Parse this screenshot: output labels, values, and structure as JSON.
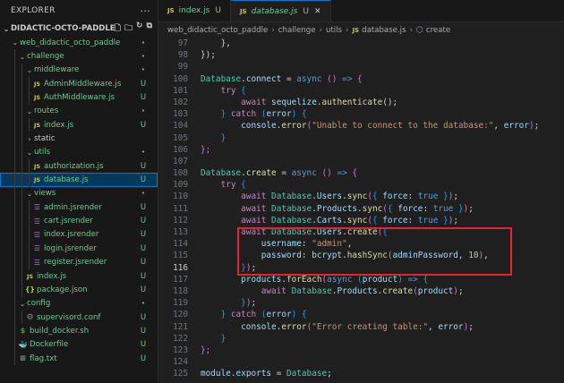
{
  "sidebar": {
    "title": "EXPLORER",
    "more": "···",
    "project": "DIDACTIC-OCTO-PADDLES",
    "tree": [
      {
        "label": "web_didactic_octo_paddle",
        "depth": 0,
        "kind": "folder-open",
        "status": "•"
      },
      {
        "label": "challenge",
        "depth": 1,
        "kind": "folder-open",
        "status": "•"
      },
      {
        "label": "middleware",
        "depth": 2,
        "kind": "folder-open",
        "status": "•"
      },
      {
        "label": "AdminMiddleware.js",
        "depth": 3,
        "kind": "js",
        "status": "U"
      },
      {
        "label": "AuthMiddleware.js",
        "depth": 3,
        "kind": "js",
        "status": "U"
      },
      {
        "label": "routes",
        "depth": 2,
        "kind": "folder-open",
        "status": "•"
      },
      {
        "label": "index.js",
        "depth": 3,
        "kind": "js",
        "status": "U"
      },
      {
        "label": "static",
        "depth": 2,
        "kind": "folder-closed",
        "status": ""
      },
      {
        "label": "utils",
        "depth": 2,
        "kind": "folder-open",
        "status": "•"
      },
      {
        "label": "authorization.js",
        "depth": 3,
        "kind": "js",
        "status": "U"
      },
      {
        "label": "database.js",
        "depth": 3,
        "kind": "js",
        "status": "U",
        "selected": true
      },
      {
        "label": "views",
        "depth": 2,
        "kind": "folder-open",
        "status": "•"
      },
      {
        "label": "admin.jsrender",
        "depth": 3,
        "kind": "jsrender",
        "status": "U"
      },
      {
        "label": "cart.jsrender",
        "depth": 3,
        "kind": "jsrender",
        "status": "U"
      },
      {
        "label": "index.jsrender",
        "depth": 3,
        "kind": "jsrender",
        "status": "U"
      },
      {
        "label": "login.jsrender",
        "depth": 3,
        "kind": "jsrender",
        "status": "U"
      },
      {
        "label": "register.jsrender",
        "depth": 3,
        "kind": "jsrender",
        "status": "U"
      },
      {
        "label": "index.js",
        "depth": 2,
        "kind": "js",
        "status": "U"
      },
      {
        "label": "package.json",
        "depth": 2,
        "kind": "json",
        "status": "U"
      },
      {
        "label": "config",
        "depth": 1,
        "kind": "folder-open",
        "status": "•"
      },
      {
        "label": "supervisord.conf",
        "depth": 2,
        "kind": "conf",
        "status": "U"
      },
      {
        "label": "build_docker.sh",
        "depth": 1,
        "kind": "sh",
        "status": "U"
      },
      {
        "label": "Dockerfile",
        "depth": 1,
        "kind": "docker",
        "status": "U"
      },
      {
        "label": "flag.txt",
        "depth": 1,
        "kind": "txt",
        "status": "U"
      }
    ]
  },
  "tabs": [
    {
      "icon": "JS",
      "label": "index.js",
      "status": "U",
      "active": false
    },
    {
      "icon": "JS",
      "label": "database.js",
      "status": "U",
      "active": true,
      "close": "✕"
    }
  ],
  "breadcrumb": {
    "items": [
      "web_didactic_octo_paddle",
      "challenge",
      "utils"
    ],
    "file_icon": "JS",
    "file": "database.js",
    "symbol": "create"
  },
  "editor": {
    "current_line": 116,
    "lines": [
      {
        "n": 97,
        "tokens": [
          [
            "    ",
            "plain"
          ],
          [
            "},",
            "punc"
          ]
        ]
      },
      {
        "n": 98,
        "tokens": [
          [
            "});",
            "punc"
          ]
        ]
      },
      {
        "n": 99,
        "tokens": []
      },
      {
        "n": 100,
        "tokens": [
          [
            "Database",
            "type"
          ],
          [
            ".",
            "punc"
          ],
          [
            "connect",
            "prop"
          ],
          [
            " = ",
            "punc"
          ],
          [
            "async",
            "kw"
          ],
          [
            " ",
            "plain"
          ],
          [
            "()",
            "paren"
          ],
          [
            " => ",
            "kw"
          ],
          [
            "{",
            "paren"
          ]
        ]
      },
      {
        "n": 101,
        "tokens": [
          [
            "    ",
            "plain"
          ],
          [
            "try",
            "kwc"
          ],
          [
            " ",
            "plain"
          ],
          [
            "{",
            "brace"
          ]
        ]
      },
      {
        "n": 102,
        "tokens": [
          [
            "        ",
            "plain"
          ],
          [
            "await",
            "kwc"
          ],
          [
            " ",
            "plain"
          ],
          [
            "sequelize",
            "prop"
          ],
          [
            ".",
            "punc"
          ],
          [
            "authenticate",
            "fn"
          ],
          [
            "();",
            "punc"
          ]
        ]
      },
      {
        "n": 103,
        "tokens": [
          [
            "    ",
            "plain"
          ],
          [
            "}",
            "brace"
          ],
          [
            " ",
            "plain"
          ],
          [
            "catch",
            "kwc"
          ],
          [
            " ",
            "plain"
          ],
          [
            "(",
            "brace"
          ],
          [
            "error",
            "prop"
          ],
          [
            ")",
            "brace"
          ],
          [
            " ",
            "plain"
          ],
          [
            "{",
            "brace"
          ]
        ]
      },
      {
        "n": 104,
        "tokens": [
          [
            "        ",
            "plain"
          ],
          [
            "console",
            "prop"
          ],
          [
            ".",
            "punc"
          ],
          [
            "error",
            "fn"
          ],
          [
            "(",
            "paren"
          ],
          [
            "\"Unable to connect to the database:\"",
            "str"
          ],
          [
            ", ",
            "punc"
          ],
          [
            "error",
            "prop"
          ],
          [
            ")",
            "paren"
          ],
          [
            ";",
            "punc"
          ]
        ]
      },
      {
        "n": 105,
        "tokens": [
          [
            "    ",
            "plain"
          ],
          [
            "}",
            "brace"
          ]
        ]
      },
      {
        "n": 106,
        "tokens": [
          [
            "};",
            "paren"
          ]
        ]
      },
      {
        "n": 107,
        "tokens": []
      },
      {
        "n": 108,
        "tokens": [
          [
            "Database",
            "type"
          ],
          [
            ".",
            "punc"
          ],
          [
            "create",
            "fn"
          ],
          [
            " = ",
            "punc"
          ],
          [
            "async",
            "kw"
          ],
          [
            " ",
            "plain"
          ],
          [
            "()",
            "paren"
          ],
          [
            " => ",
            "kw"
          ],
          [
            "{",
            "paren"
          ]
        ]
      },
      {
        "n": 109,
        "tokens": [
          [
            "    ",
            "plain"
          ],
          [
            "try",
            "kwc"
          ],
          [
            " ",
            "plain"
          ],
          [
            "{",
            "brace"
          ]
        ]
      },
      {
        "n": 110,
        "tokens": [
          [
            "        ",
            "plain"
          ],
          [
            "await",
            "kwc"
          ],
          [
            " ",
            "plain"
          ],
          [
            "Database",
            "type"
          ],
          [
            ".",
            "punc"
          ],
          [
            "Users",
            "prop"
          ],
          [
            ".",
            "punc"
          ],
          [
            "sync",
            "fn"
          ],
          [
            "(",
            "paren"
          ],
          [
            "{ ",
            "brace"
          ],
          [
            "force",
            "prop"
          ],
          [
            ": ",
            "punc"
          ],
          [
            "true",
            "kw"
          ],
          [
            " }",
            "brace"
          ],
          [
            ")",
            "paren"
          ],
          [
            ";",
            "punc"
          ]
        ]
      },
      {
        "n": 111,
        "tokens": [
          [
            "        ",
            "plain"
          ],
          [
            "await",
            "kwc"
          ],
          [
            " ",
            "plain"
          ],
          [
            "Database",
            "type"
          ],
          [
            ".",
            "punc"
          ],
          [
            "Products",
            "prop"
          ],
          [
            ".",
            "punc"
          ],
          [
            "sync",
            "fn"
          ],
          [
            "(",
            "paren"
          ],
          [
            "{ ",
            "brace"
          ],
          [
            "force",
            "prop"
          ],
          [
            ": ",
            "punc"
          ],
          [
            "true",
            "kw"
          ],
          [
            " }",
            "brace"
          ],
          [
            ")",
            "paren"
          ],
          [
            ";",
            "punc"
          ]
        ]
      },
      {
        "n": 112,
        "tokens": [
          [
            "        ",
            "plain"
          ],
          [
            "await",
            "kwc"
          ],
          [
            " ",
            "plain"
          ],
          [
            "Database",
            "type"
          ],
          [
            ".",
            "punc"
          ],
          [
            "Carts",
            "prop"
          ],
          [
            ".",
            "punc"
          ],
          [
            "sync",
            "fn"
          ],
          [
            "(",
            "paren"
          ],
          [
            "{ ",
            "brace"
          ],
          [
            "force",
            "prop"
          ],
          [
            ": ",
            "punc"
          ],
          [
            "true",
            "kw"
          ],
          [
            " }",
            "brace"
          ],
          [
            ")",
            "paren"
          ],
          [
            ";",
            "punc"
          ]
        ]
      },
      {
        "n": 113,
        "tokens": [
          [
            "        ",
            "plain"
          ],
          [
            "await",
            "kwc"
          ],
          [
            " ",
            "plain"
          ],
          [
            "Database",
            "type"
          ],
          [
            ".",
            "punc"
          ],
          [
            "Users",
            "prop"
          ],
          [
            ".",
            "punc"
          ],
          [
            "create",
            "fn"
          ],
          [
            "(",
            "paren"
          ],
          [
            "{",
            "brace"
          ]
        ]
      },
      {
        "n": 114,
        "tokens": [
          [
            "            ",
            "plain"
          ],
          [
            "username",
            "prop"
          ],
          [
            ": ",
            "punc"
          ],
          [
            "\"admin\"",
            "str"
          ],
          [
            ",",
            "punc"
          ]
        ]
      },
      {
        "n": 115,
        "tokens": [
          [
            "            ",
            "plain"
          ],
          [
            "password",
            "prop"
          ],
          [
            ": ",
            "punc"
          ],
          [
            "bcrypt",
            "prop"
          ],
          [
            ".",
            "punc"
          ],
          [
            "hashSync",
            "fn"
          ],
          [
            "(",
            "paren"
          ],
          [
            "adminPassword",
            "prop"
          ],
          [
            ", ",
            "punc"
          ],
          [
            "10",
            "num"
          ],
          [
            ")",
            "paren"
          ],
          [
            ",",
            "punc"
          ]
        ]
      },
      {
        "n": 116,
        "tokens": [
          [
            "        ",
            "plain"
          ],
          [
            "}",
            "brace"
          ],
          [
            ")",
            "paren"
          ],
          [
            ";",
            "punc"
          ]
        ]
      },
      {
        "n": 117,
        "tokens": [
          [
            "        ",
            "plain"
          ],
          [
            "products",
            "prop"
          ],
          [
            ".",
            "punc"
          ],
          [
            "forEach",
            "fn"
          ],
          [
            "(",
            "paren"
          ],
          [
            "async",
            "kw"
          ],
          [
            " ",
            "plain"
          ],
          [
            "(",
            "brace"
          ],
          [
            "product",
            "prop"
          ],
          [
            ")",
            "brace"
          ],
          [
            " => ",
            "kw"
          ],
          [
            "{",
            "brace"
          ]
        ]
      },
      {
        "n": 118,
        "tokens": [
          [
            "            ",
            "plain"
          ],
          [
            "await",
            "kwc"
          ],
          [
            " ",
            "plain"
          ],
          [
            "Database",
            "type"
          ],
          [
            ".",
            "punc"
          ],
          [
            "Products",
            "prop"
          ],
          [
            ".",
            "punc"
          ],
          [
            "create",
            "fn"
          ],
          [
            "(",
            "paren"
          ],
          [
            "product",
            "prop"
          ],
          [
            ")",
            "paren"
          ],
          [
            ";",
            "punc"
          ]
        ]
      },
      {
        "n": 119,
        "tokens": [
          [
            "        ",
            "plain"
          ],
          [
            "}",
            "brace"
          ],
          [
            ")",
            "paren"
          ],
          [
            ";",
            "punc"
          ]
        ]
      },
      {
        "n": 120,
        "tokens": [
          [
            "    ",
            "plain"
          ],
          [
            "}",
            "brace"
          ],
          [
            " ",
            "plain"
          ],
          [
            "catch",
            "kwc"
          ],
          [
            " ",
            "plain"
          ],
          [
            "(",
            "brace"
          ],
          [
            "error",
            "prop"
          ],
          [
            ")",
            "brace"
          ],
          [
            " ",
            "plain"
          ],
          [
            "{",
            "brace"
          ]
        ]
      },
      {
        "n": 121,
        "tokens": [
          [
            "        ",
            "plain"
          ],
          [
            "console",
            "prop"
          ],
          [
            ".",
            "punc"
          ],
          [
            "error",
            "fn"
          ],
          [
            "(",
            "paren"
          ],
          [
            "\"Error creating table:\"",
            "str"
          ],
          [
            ", ",
            "punc"
          ],
          [
            "error",
            "prop"
          ],
          [
            ")",
            "paren"
          ],
          [
            ";",
            "punc"
          ]
        ]
      },
      {
        "n": 122,
        "tokens": [
          [
            "    ",
            "plain"
          ],
          [
            "}",
            "brace"
          ]
        ]
      },
      {
        "n": 123,
        "tokens": [
          [
            "};",
            "paren"
          ]
        ]
      },
      {
        "n": 124,
        "tokens": []
      },
      {
        "n": 125,
        "tokens": [
          [
            "module",
            "prop"
          ],
          [
            ".",
            "punc"
          ],
          [
            "exports",
            "prop"
          ],
          [
            " = ",
            "punc"
          ],
          [
            "Database",
            "type"
          ],
          [
            ";",
            "punc"
          ]
        ]
      }
    ]
  },
  "colors": {
    "selection_bg": "#04395e",
    "accent": "#0078d4",
    "untracked": "#73c991",
    "highlight_box": "#e0272c"
  }
}
